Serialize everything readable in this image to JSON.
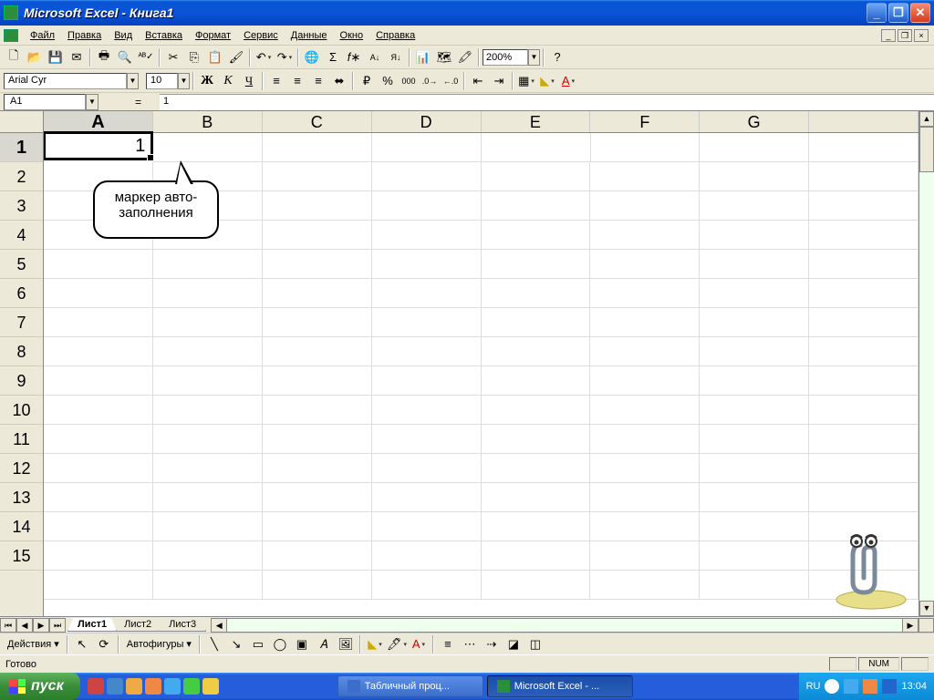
{
  "window": {
    "title": "Microsoft Excel - Книга1"
  },
  "menu": {
    "items": [
      "Файл",
      "Правка",
      "Вид",
      "Вставка",
      "Формат",
      "Сервис",
      "Данные",
      "Окно",
      "Справка"
    ]
  },
  "toolbar": {
    "zoom": "200%"
  },
  "format": {
    "font": "Arial Cyr",
    "size": "10",
    "bold": "Ж",
    "italic": "К",
    "underline": "Ч"
  },
  "formula": {
    "namebox": "A1",
    "value": "1"
  },
  "grid": {
    "columns": [
      "A",
      "B",
      "C",
      "D",
      "E",
      "F",
      "G"
    ],
    "rows": [
      "1",
      "2",
      "3",
      "4",
      "5",
      "6",
      "7",
      "8",
      "9",
      "10",
      "11",
      "12",
      "13",
      "14",
      "15"
    ],
    "active_cell": {
      "col": "A",
      "row": "1",
      "value": "1"
    }
  },
  "callout": {
    "line1": "маркер авто-",
    "line2": "заполнения"
  },
  "sheets": {
    "tabs": [
      "Лист1",
      "Лист2",
      "Лист3"
    ],
    "active": 0
  },
  "drawbar": {
    "actions": "Действия",
    "autoshapes": "Автофигуры"
  },
  "status": {
    "ready": "Готово",
    "num": "NUM"
  },
  "taskbar": {
    "start": "пуск",
    "task1": "Табличный проц...",
    "task2": "Microsoft Excel - ...",
    "lang": "RU",
    "clock": "13:04"
  }
}
